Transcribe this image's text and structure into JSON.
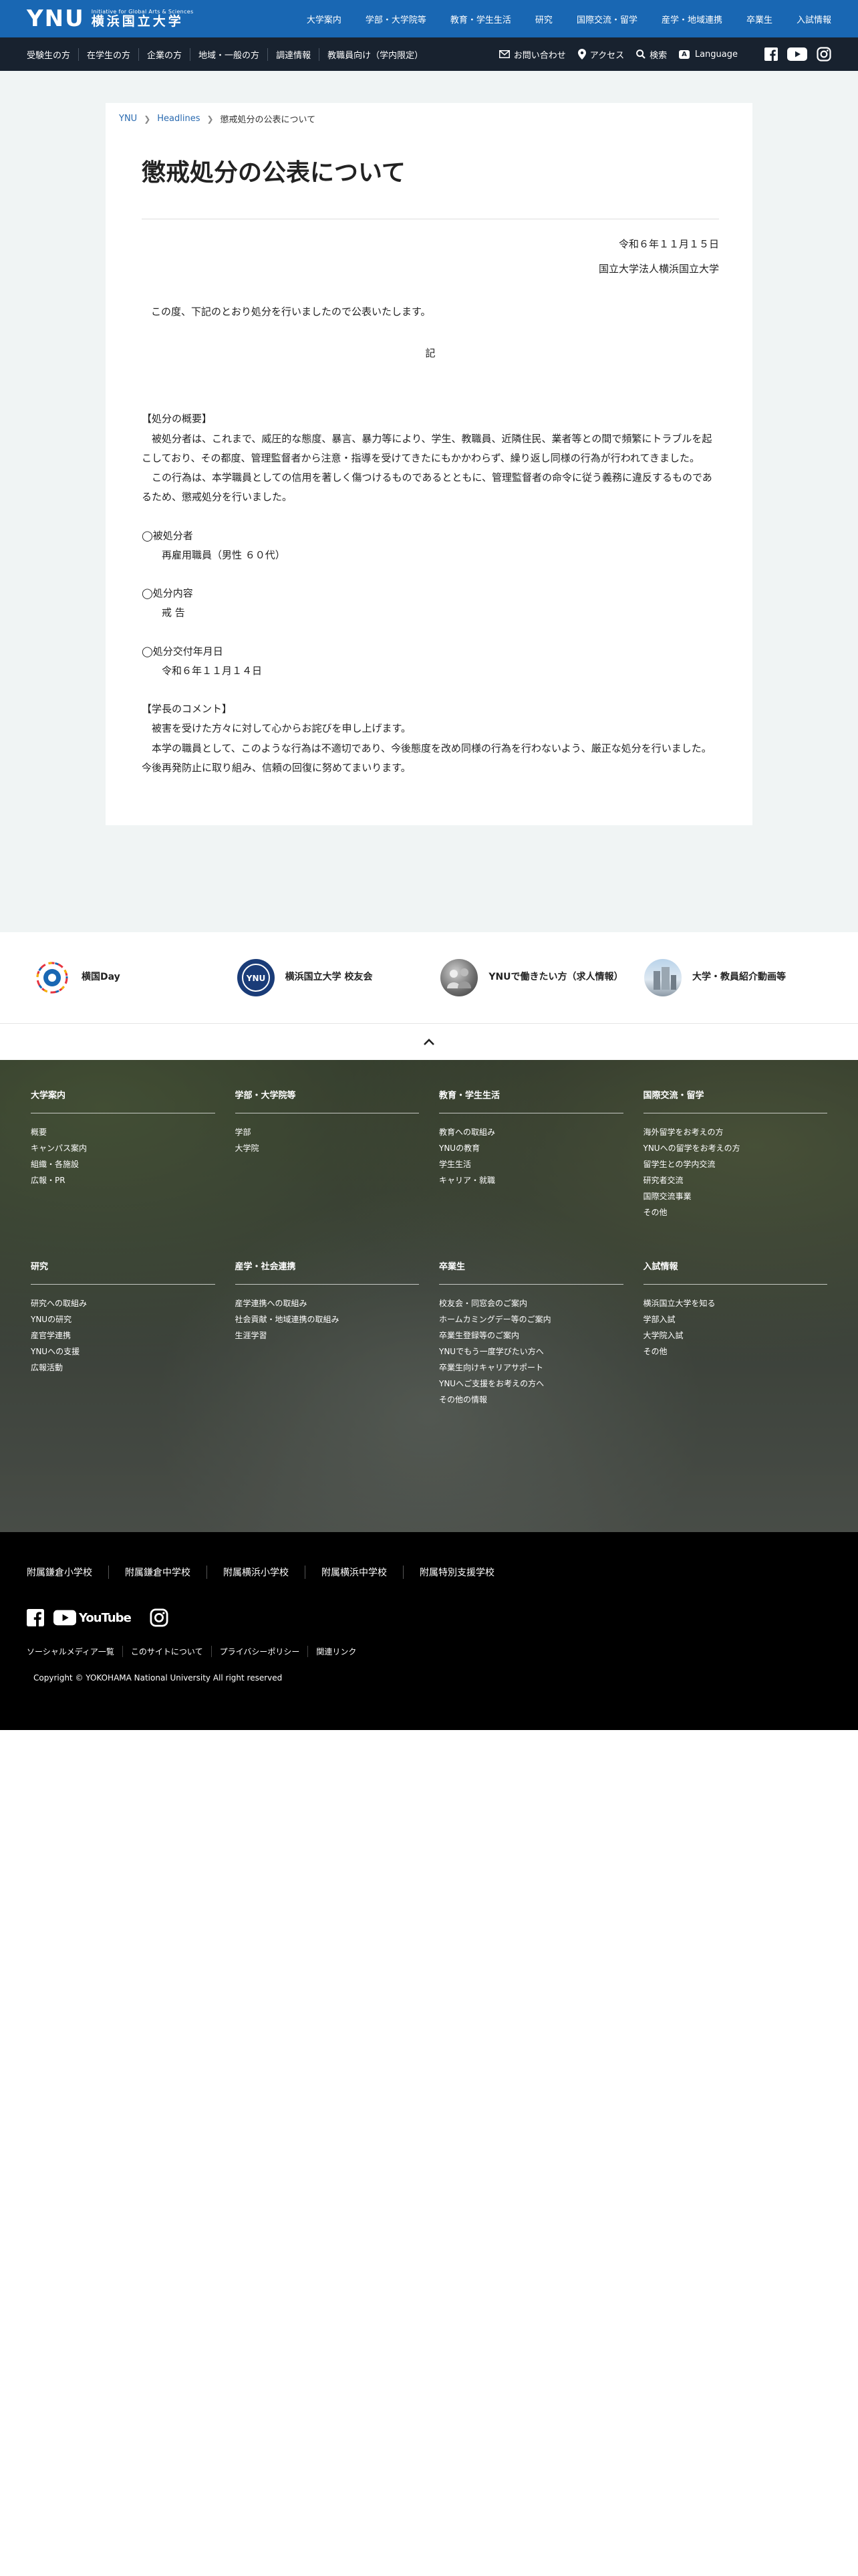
{
  "header": {
    "logo_text": "YNU",
    "tagline": "Initiative for Global Arts & Sciences",
    "university_name": "横浜国立大学",
    "main_nav": [
      "大学案内",
      "学部・大学院等",
      "教育・学生生活",
      "研究",
      "国際交流・留学",
      "産学・地域連携",
      "卒業生",
      "入試情報"
    ]
  },
  "subheader": {
    "audience_links": [
      "受験生の方",
      "在学生の方",
      "企業の方",
      "地域・一般の方",
      "調達情報",
      "教職員向け（学内限定）"
    ],
    "contact": "お問い合わせ",
    "access": "アクセス",
    "search": "検索",
    "language_badge": "A",
    "language": "Language"
  },
  "breadcrumb": {
    "home": "YNU",
    "section": "Headlines",
    "current": "懲戒処分の公表について"
  },
  "article": {
    "title": "懲戒処分の公表について",
    "date": "令和６年１１月１５日",
    "org": "国立大学法人横浜国立大学",
    "intro": "この度、下記のとおり処分を行いましたので公表いたします。",
    "ki": "記",
    "overview_heading": "【処分の概要】",
    "overview_p1": "被処分者は、これまで、威圧的な態度、暴言、暴力等により、学生、教職員、近隣住民、業者等との間で頻繁にトラブルを起こしており、その都度、管理監督者から注意・指導を受けてきたにもかかわらず、繰り返し同様の行為が行われてきました。",
    "overview_p2": "この行為は、本学職員としての信用を著しく傷つけるものであるとともに、管理監督者の命令に従う義務に違反するものであるため、懲戒処分を行いました。",
    "subject_heading": "◯被処分者",
    "subject_value": "再雇用職員（男性 ６０代）",
    "content_heading": "◯処分内容",
    "content_value": "戒 告",
    "issued_heading": "◯処分交付年月日",
    "issued_value": "令和６年１１月１４日",
    "comment_heading": "【学長のコメント】",
    "comment_p1": "被害を受けた方々に対して心からお詫びを申し上げます。",
    "comment_p2": "本学の職員として、このような行為は不適切であり、今後態度を改め同様の行為を行わないよう、厳正な処分を行いました。今後再発防止に取り組み、信頼の回復に努めてまいります。"
  },
  "banners": [
    {
      "label": "横国Day",
      "icon": "yokokoku-day-logo"
    },
    {
      "label": "横浜国立大学 校友会",
      "icon": "alumni-logo",
      "icon_text": "YNU"
    },
    {
      "label": "YNUで働きたい方（求人情報）",
      "icon": "people-photo"
    },
    {
      "label": "大学・教員紹介動画等",
      "icon": "building-photo"
    }
  ],
  "footer_nav": [
    {
      "heading": "大学案内",
      "links": [
        "概要",
        "キャンパス案内",
        "組織・各施設",
        "広報・PR"
      ]
    },
    {
      "heading": "学部・大学院等",
      "links": [
        "学部",
        "大学院"
      ]
    },
    {
      "heading": "教育・学生生活",
      "links": [
        "教育への取組み",
        "YNUの教育",
        "学生生活",
        "キャリア・就職"
      ]
    },
    {
      "heading": "国際交流・留学",
      "links": [
        "海外留学をお考えの方",
        "YNUへの留学をお考えの方",
        "留学生との学内交流",
        "研究者交流",
        "国際交流事業",
        "その他"
      ]
    },
    {
      "heading": "研究",
      "links": [
        "研究への取組み",
        "YNUの研究",
        "産官学連携",
        "YNUへの支援",
        "広報活動"
      ]
    },
    {
      "heading": "産学・社会連携",
      "links": [
        "産学連携への取組み",
        "社会貢献・地域連携の取組み",
        "生涯学習"
      ]
    },
    {
      "heading": "卒業生",
      "links": [
        "校友会・同窓会のご案内",
        "ホームカミングデー等のご案内",
        "卒業生登録等のご案内",
        "YNUでもう一度学びたい方へ",
        "卒業生向けキャリアサポート",
        "YNUへご支援をお考えの方へ",
        "その他の情報"
      ]
    },
    {
      "heading": "入試情報",
      "links": [
        "横浜国立大学を知る",
        "学部入試",
        "大学院入試",
        "その他"
      ]
    }
  ],
  "footer": {
    "schools": [
      "附属鎌倉小学校",
      "附属鎌倉中学校",
      "附属横浜小学校",
      "附属横浜中学校",
      "附属特別支援学校"
    ],
    "youtube_text": "YouTube",
    "links": [
      "ソーシャルメディア一覧",
      "このサイトについて",
      "プライバシーポリシー",
      "関連リンク"
    ],
    "copyright": "Copyright © YOKOHAMA National University All right reserved"
  },
  "colors": {
    "brand_blue": "#1967b3",
    "subbar_dark": "#18222f",
    "content_bg": "#f0f4f4",
    "footer_black": "#000000"
  }
}
